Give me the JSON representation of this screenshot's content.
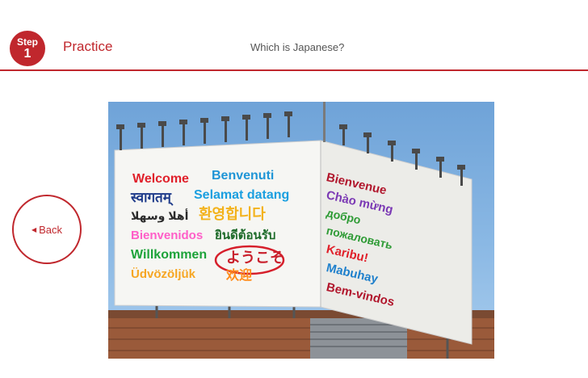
{
  "header": {
    "step_word": "Step",
    "step_number": "1",
    "title": "Practice",
    "question": "Which is Japanese?"
  },
  "back": {
    "label": "Back"
  },
  "billboard": {
    "left_panel": [
      {
        "text": "Welcome",
        "color": "#e0202a"
      },
      {
        "text": "Benvenuti",
        "color": "#1f95d6"
      },
      {
        "text": "स्वागतम्",
        "color": "#1e3b8a"
      },
      {
        "text": "Selamat datang",
        "color": "#1a9fe0"
      },
      {
        "text": "أهلا وسهلا",
        "color": "#2a2a2a"
      },
      {
        "text": "환영합니다",
        "color": "#f3b21b"
      },
      {
        "text": "Bienvenidos",
        "color": "#ff5ec8"
      },
      {
        "text": "ยินดีต้อนรับ",
        "color": "#1e6b2a"
      },
      {
        "text": "Willkommen",
        "color": "#1da33a"
      },
      {
        "text": "ようこそ",
        "color": "#c9202c"
      },
      {
        "text": "Üdvözöljük",
        "color": "#f6a623"
      },
      {
        "text": "欢迎",
        "color": "#ff8c1a"
      }
    ],
    "right_panel": [
      {
        "text": "Bienvenue",
        "color": "#b1162c"
      },
      {
        "text": "Chào mừng",
        "color": "#7b39b4"
      },
      {
        "text": "добро",
        "color": "#2e9b35"
      },
      {
        "text": "пожаловать",
        "color": "#2e9b35"
      },
      {
        "text": "Karibu!",
        "color": "#e0202a"
      },
      {
        "text": "Mabuhay",
        "color": "#1f80cc"
      },
      {
        "text": "Bem-vindos",
        "color": "#b1162c"
      }
    ],
    "highlight_color": "#d61f2b"
  }
}
